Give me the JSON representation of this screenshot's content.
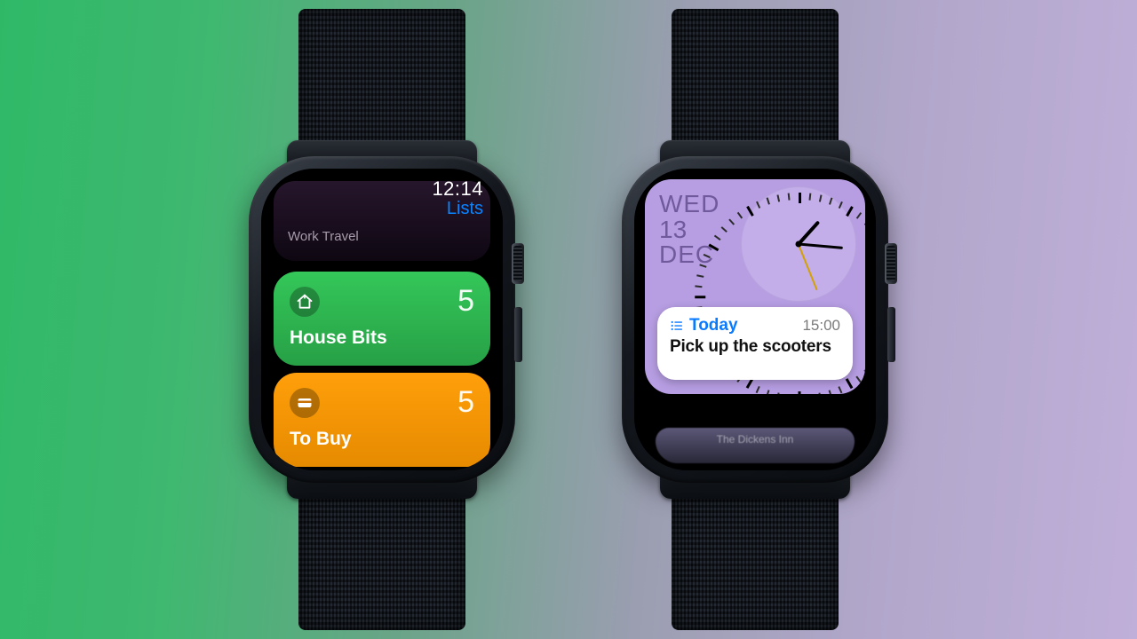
{
  "left": {
    "time": "12:14",
    "nav_label": "Lists",
    "prev_card_label": "Work Travel",
    "cards": [
      {
        "icon": "home-icon",
        "title": "House Bits",
        "count": "5",
        "color": "green"
      },
      {
        "icon": "card-icon",
        "title": "To Buy",
        "count": "5",
        "color": "orange"
      }
    ]
  },
  "right": {
    "date": {
      "dow": "WED",
      "dom": "13",
      "mon": "DEC"
    },
    "analog_time_approx": "1:17",
    "reminder": {
      "list_label": "Today",
      "time": "15:00",
      "text": "Pick up the scooters"
    },
    "peek_text": "The Dickens Inn"
  }
}
